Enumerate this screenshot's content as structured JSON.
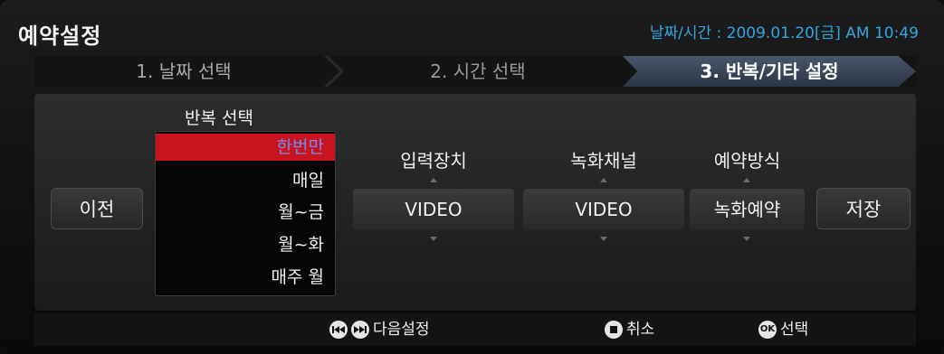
{
  "header": {
    "title": "예약설정",
    "datetime": "날짜/시간 : 2009.01.20[금] AM 10:49",
    "accent_color": "#2fa6e0"
  },
  "steps": [
    {
      "label": "1. 날짜 선택",
      "active": false
    },
    {
      "label": "2. 시간 선택",
      "active": false
    },
    {
      "label": "3. 반복/기타 설정",
      "active": true
    }
  ],
  "buttons": {
    "prev": "이전",
    "save": "저장"
  },
  "repeat": {
    "label": "반복 선택",
    "selected_color": "#c8141f",
    "options": [
      "한번만",
      "매일",
      "월~금",
      "월~화",
      "매주 월"
    ],
    "selected": "한번만"
  },
  "input_device": {
    "label": "입력장치",
    "value": "VIDEO"
  },
  "record_channel": {
    "label": "녹화채널",
    "value": "VIDEO"
  },
  "reserve_method": {
    "label": "예약방식",
    "value": "녹화예약"
  },
  "footer": {
    "next_setting": "다음설정",
    "cancel": "취소",
    "select": "선택",
    "ok_icon_text": "OK",
    "icons": [
      "skip-back-icon",
      "skip-forward-icon",
      "stop-icon",
      "ok-icon"
    ]
  }
}
